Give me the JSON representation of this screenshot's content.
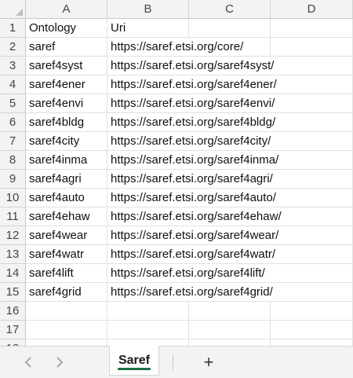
{
  "columns": [
    "A",
    "B",
    "C",
    "D"
  ],
  "rows": [
    {
      "n": "1",
      "a": "Ontology",
      "b": "Uri"
    },
    {
      "n": "2",
      "a": "saref",
      "b": "https://saref.etsi.org/core/"
    },
    {
      "n": "3",
      "a": "saref4syst",
      "b": "https://saref.etsi.org/saref4syst/"
    },
    {
      "n": "4",
      "a": "saref4ener",
      "b": "https://saref.etsi.org/saref4ener/"
    },
    {
      "n": "5",
      "a": "saref4envi",
      "b": "https://saref.etsi.org/saref4envi/"
    },
    {
      "n": "6",
      "a": "saref4bldg",
      "b": "https://saref.etsi.org/saref4bldg/"
    },
    {
      "n": "7",
      "a": "saref4city",
      "b": "https://saref.etsi.org/saref4city/"
    },
    {
      "n": "8",
      "a": "saref4inma",
      "b": "https://saref.etsi.org/saref4inma/"
    },
    {
      "n": "9",
      "a": "saref4agri",
      "b": "https://saref.etsi.org/saref4agri/"
    },
    {
      "n": "10",
      "a": "saref4auto",
      "b": "https://saref.etsi.org/saref4auto/"
    },
    {
      "n": "11",
      "a": "saref4ehaw",
      "b": "https://saref.etsi.org/saref4ehaw/"
    },
    {
      "n": "12",
      "a": "saref4wear",
      "b": "https://saref.etsi.org/saref4wear/"
    },
    {
      "n": "13",
      "a": "saref4watr",
      "b": "https://saref.etsi.org/saref4watr/"
    },
    {
      "n": "14",
      "a": "saref4lift",
      "b": "https://saref.etsi.org/saref4lift/"
    },
    {
      "n": "15",
      "a": "saref4grid",
      "b": "https://saref.etsi.org/saref4grid/"
    },
    {
      "n": "16",
      "a": "",
      "b": ""
    },
    {
      "n": "17",
      "a": "",
      "b": ""
    },
    {
      "n": "18",
      "a": "",
      "b": ""
    }
  ],
  "tabbar": {
    "prev_icon": "chevron-left-icon",
    "next_icon": "chevron-right-icon",
    "active_sheet": "Saref",
    "add_icon": "plus-icon",
    "add_label": "+",
    "accent_color": "#1e7145"
  }
}
